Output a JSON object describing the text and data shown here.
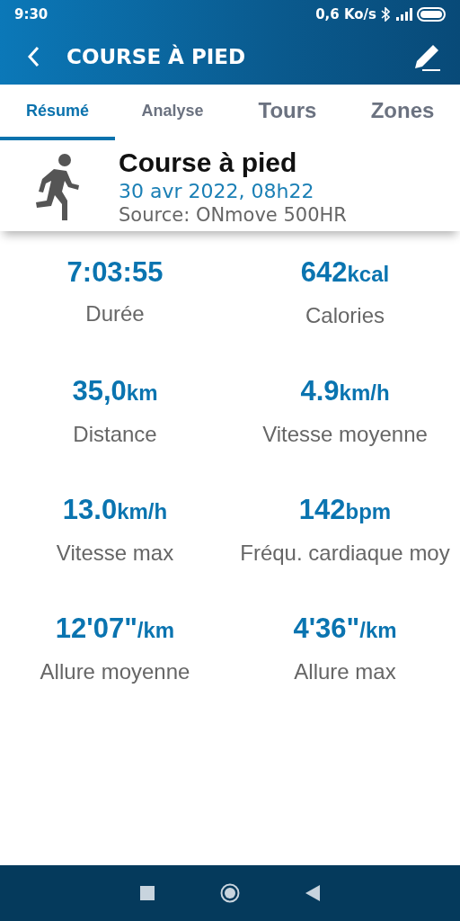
{
  "status_bar": {
    "time": "9:30",
    "speed": "0,6 Ko/s"
  },
  "header": {
    "title": "COURSE À PIED"
  },
  "tabs": [
    {
      "label": "Résumé",
      "selected": true
    },
    {
      "label": "Analyse",
      "selected": false
    },
    {
      "label": "Tours",
      "selected": false
    },
    {
      "label": "Zones",
      "selected": false
    }
  ],
  "activity": {
    "name": "Course à pied",
    "date": "30 avr 2022, 08h22",
    "source": "Source: ONmove 500HR"
  },
  "stats": [
    {
      "value": "7:03:55",
      "label": "Durée"
    },
    {
      "value": "642",
      "unit": "kcal",
      "label": "Calories"
    },
    {
      "value": "35,0",
      "unit": "km",
      "label": "Distance"
    },
    {
      "value": "4.9",
      "unit": "km/h",
      "label": "Vitesse moyenne"
    },
    {
      "value": "13.0",
      "unit": "km/h",
      "label": "Vitesse max"
    },
    {
      "value": "142",
      "unit": "bpm",
      "label": "Fréqu. cardiaque moy"
    },
    {
      "value": "12'07\"",
      "unit": "/km",
      "label": "Allure moyenne"
    },
    {
      "value": "4'36\"",
      "unit": "/km",
      "label": "Allure max"
    }
  ]
}
